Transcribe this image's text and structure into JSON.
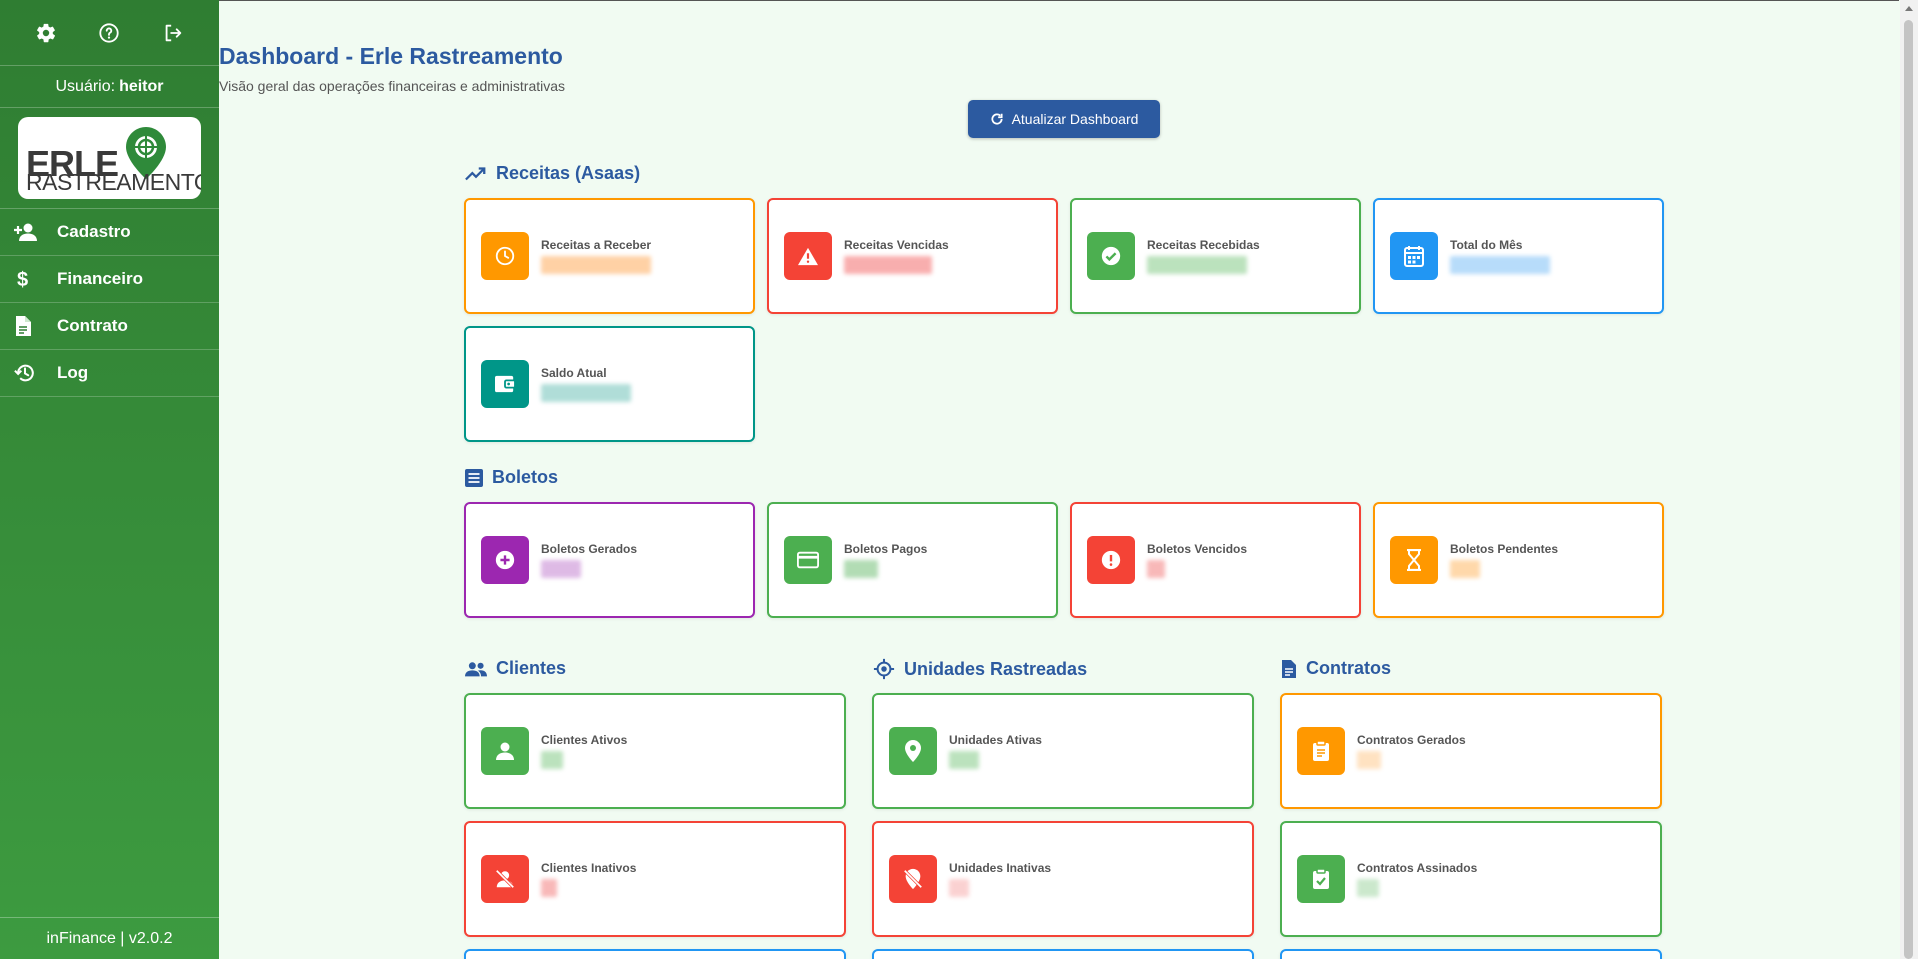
{
  "sidebar": {
    "user_prefix": "Usuário:",
    "user_name": "heitor",
    "logo_top": "ERLE",
    "logo_bottom": "RASTREAMENTO",
    "items": [
      {
        "label": "Cadastro",
        "icon": "user-plus-icon"
      },
      {
        "label": "Financeiro",
        "icon": "dollar-icon"
      },
      {
        "label": "Contrato",
        "icon": "document-icon"
      },
      {
        "label": "Log",
        "icon": "history-icon"
      }
    ],
    "footer": "inFinance | v2.0.2"
  },
  "header": {
    "title": "Dashboard - Erle Rastreamento",
    "subtitle": "Visão geral das operações financeiras e administrativas",
    "refresh_label": "Atualizar Dashboard"
  },
  "sections": {
    "receitas": "Receitas (Asaas)",
    "boletos": "Boletos",
    "clientes": "Clientes",
    "unidades": "Unidades Rastreadas",
    "contratos": "Contratos"
  },
  "cards": {
    "receitas_a_receber": "Receitas a Receber",
    "receitas_vencidas": "Receitas Vencidas",
    "receitas_recebidas": "Receitas Recebidas",
    "total_do_mes": "Total do Mês",
    "saldo_atual": "Saldo Atual",
    "boletos_gerados": "Boletos Gerados",
    "boletos_pagos": "Boletos Pagos",
    "boletos_vencidos": "Boletos Vencidos",
    "boletos_pendentes": "Boletos Pendentes",
    "clientes_ativos": "Clientes Ativos",
    "clientes_inativos": "Clientes Inativos",
    "unidades_ativas": "Unidades Ativas",
    "unidades_inativas": "Unidades Inativas",
    "contratos_gerados": "Contratos Gerados",
    "contratos_assinados": "Contratos Assinados"
  },
  "colors": {
    "sidebar": "#2f7d32",
    "accent": "#2c5aa0",
    "orange": "#ff9800",
    "red": "#f44336",
    "green": "#4caf50",
    "blue": "#2196f3",
    "teal": "#009688",
    "purple": "#9c27b0"
  }
}
